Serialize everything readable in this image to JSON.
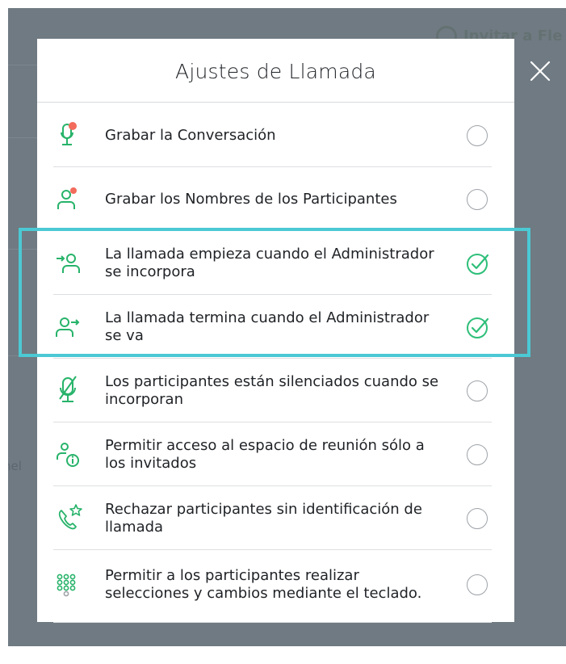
{
  "dialog": {
    "title": "Ajustes de Llamada",
    "close_icon": "close-icon"
  },
  "background": {
    "fragment_text": "Invitar a Fle",
    "fragment2_text": "nel"
  },
  "settings": [
    {
      "label": "Grabar la Conversación",
      "icon": "microphone-record-icon",
      "checked": false
    },
    {
      "label": "Grabar los Nombres de los Participantes",
      "icon": "user-record-icon",
      "checked": false
    },
    {
      "label": "La llamada empieza cuando el Administrador se incorpora",
      "icon": "user-enter-icon",
      "checked": true
    },
    {
      "label": "La llamada termina cuando el Administrador se va",
      "icon": "user-exit-icon",
      "checked": true
    },
    {
      "label": "Los participantes están silenciados cuando se incorporan",
      "icon": "microphone-muted-icon",
      "checked": false
    },
    {
      "label": "Permitir acceso al espacio de reunión sólo a los invitados",
      "icon": "user-info-icon",
      "checked": false
    },
    {
      "label": "Rechazar participantes sin identificación de llamada",
      "icon": "phone-star-icon",
      "checked": false
    },
    {
      "label": "Permitir a los participantes realizar selecciones y cambios mediante el teclado.",
      "icon": "keypad-icon",
      "checked": false
    }
  ],
  "colors": {
    "accent_green": "#2fbf7a",
    "icon_green": "#27b36a",
    "record_red": "#f26b5b",
    "highlight_cyan": "#4bc9d4",
    "backdrop": "#6f7a82"
  }
}
